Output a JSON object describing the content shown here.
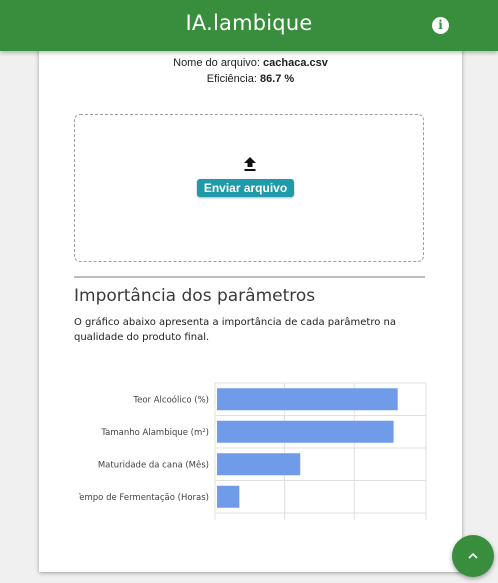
{
  "app": {
    "title": "IA.lambique",
    "info_icon": "info-icon"
  },
  "file_info": {
    "name_label": "Nome do arquivo: ",
    "name_value": "cachaca.csv",
    "efficiency_label": "Eficiência: ",
    "efficiency_value": "86.7 %"
  },
  "upload": {
    "icon": "upload-icon",
    "button_label": "Enviar arquivo"
  },
  "importance": {
    "title": "Importância dos parâmetros",
    "description": "O gráfico abaixo apresenta a importância de cada parâmetro na qualidade do produto final."
  },
  "chart_data": {
    "type": "bar",
    "orientation": "horizontal",
    "categories": [
      "Teor Alcoólico (%)",
      "Tamanho Alambique (m²)",
      "Maturidade da cana (Mês)",
      "Tempo de Fermentação (Horas)"
    ],
    "values": [
      0.89,
      0.87,
      0.41,
      0.11
    ],
    "xlim": [
      0,
      1.0
    ],
    "grid": true,
    "color": "#6f9be8"
  },
  "fab": {
    "icon": "chevron-up-icon"
  }
}
